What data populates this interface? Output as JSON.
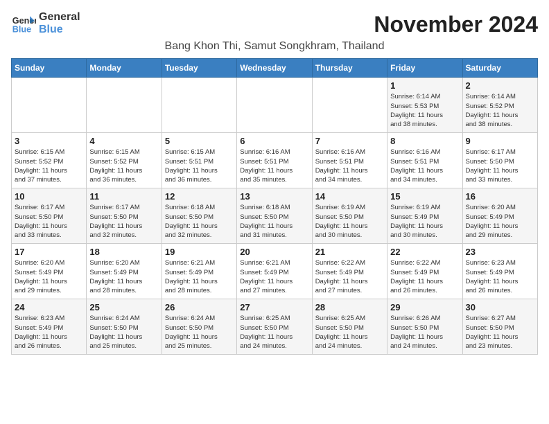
{
  "logo": {
    "line1": "General",
    "line2": "Blue"
  },
  "title": "November 2024",
  "subtitle": "Bang Khon Thi, Samut Songkhram, Thailand",
  "days_of_week": [
    "Sunday",
    "Monday",
    "Tuesday",
    "Wednesday",
    "Thursday",
    "Friday",
    "Saturday"
  ],
  "weeks": [
    [
      {
        "day": "",
        "info": ""
      },
      {
        "day": "",
        "info": ""
      },
      {
        "day": "",
        "info": ""
      },
      {
        "day": "",
        "info": ""
      },
      {
        "day": "",
        "info": ""
      },
      {
        "day": "1",
        "info": "Sunrise: 6:14 AM\nSunset: 5:53 PM\nDaylight: 11 hours\nand 38 minutes."
      },
      {
        "day": "2",
        "info": "Sunrise: 6:14 AM\nSunset: 5:52 PM\nDaylight: 11 hours\nand 38 minutes."
      }
    ],
    [
      {
        "day": "3",
        "info": "Sunrise: 6:15 AM\nSunset: 5:52 PM\nDaylight: 11 hours\nand 37 minutes."
      },
      {
        "day": "4",
        "info": "Sunrise: 6:15 AM\nSunset: 5:52 PM\nDaylight: 11 hours\nand 36 minutes."
      },
      {
        "day": "5",
        "info": "Sunrise: 6:15 AM\nSunset: 5:51 PM\nDaylight: 11 hours\nand 36 minutes."
      },
      {
        "day": "6",
        "info": "Sunrise: 6:16 AM\nSunset: 5:51 PM\nDaylight: 11 hours\nand 35 minutes."
      },
      {
        "day": "7",
        "info": "Sunrise: 6:16 AM\nSunset: 5:51 PM\nDaylight: 11 hours\nand 34 minutes."
      },
      {
        "day": "8",
        "info": "Sunrise: 6:16 AM\nSunset: 5:51 PM\nDaylight: 11 hours\nand 34 minutes."
      },
      {
        "day": "9",
        "info": "Sunrise: 6:17 AM\nSunset: 5:50 PM\nDaylight: 11 hours\nand 33 minutes."
      }
    ],
    [
      {
        "day": "10",
        "info": "Sunrise: 6:17 AM\nSunset: 5:50 PM\nDaylight: 11 hours\nand 33 minutes."
      },
      {
        "day": "11",
        "info": "Sunrise: 6:17 AM\nSunset: 5:50 PM\nDaylight: 11 hours\nand 32 minutes."
      },
      {
        "day": "12",
        "info": "Sunrise: 6:18 AM\nSunset: 5:50 PM\nDaylight: 11 hours\nand 32 minutes."
      },
      {
        "day": "13",
        "info": "Sunrise: 6:18 AM\nSunset: 5:50 PM\nDaylight: 11 hours\nand 31 minutes."
      },
      {
        "day": "14",
        "info": "Sunrise: 6:19 AM\nSunset: 5:50 PM\nDaylight: 11 hours\nand 30 minutes."
      },
      {
        "day": "15",
        "info": "Sunrise: 6:19 AM\nSunset: 5:49 PM\nDaylight: 11 hours\nand 30 minutes."
      },
      {
        "day": "16",
        "info": "Sunrise: 6:20 AM\nSunset: 5:49 PM\nDaylight: 11 hours\nand 29 minutes."
      }
    ],
    [
      {
        "day": "17",
        "info": "Sunrise: 6:20 AM\nSunset: 5:49 PM\nDaylight: 11 hours\nand 29 minutes."
      },
      {
        "day": "18",
        "info": "Sunrise: 6:20 AM\nSunset: 5:49 PM\nDaylight: 11 hours\nand 28 minutes."
      },
      {
        "day": "19",
        "info": "Sunrise: 6:21 AM\nSunset: 5:49 PM\nDaylight: 11 hours\nand 28 minutes."
      },
      {
        "day": "20",
        "info": "Sunrise: 6:21 AM\nSunset: 5:49 PM\nDaylight: 11 hours\nand 27 minutes."
      },
      {
        "day": "21",
        "info": "Sunrise: 6:22 AM\nSunset: 5:49 PM\nDaylight: 11 hours\nand 27 minutes."
      },
      {
        "day": "22",
        "info": "Sunrise: 6:22 AM\nSunset: 5:49 PM\nDaylight: 11 hours\nand 26 minutes."
      },
      {
        "day": "23",
        "info": "Sunrise: 6:23 AM\nSunset: 5:49 PM\nDaylight: 11 hours\nand 26 minutes."
      }
    ],
    [
      {
        "day": "24",
        "info": "Sunrise: 6:23 AM\nSunset: 5:49 PM\nDaylight: 11 hours\nand 26 minutes."
      },
      {
        "day": "25",
        "info": "Sunrise: 6:24 AM\nSunset: 5:50 PM\nDaylight: 11 hours\nand 25 minutes."
      },
      {
        "day": "26",
        "info": "Sunrise: 6:24 AM\nSunset: 5:50 PM\nDaylight: 11 hours\nand 25 minutes."
      },
      {
        "day": "27",
        "info": "Sunrise: 6:25 AM\nSunset: 5:50 PM\nDaylight: 11 hours\nand 24 minutes."
      },
      {
        "day": "28",
        "info": "Sunrise: 6:25 AM\nSunset: 5:50 PM\nDaylight: 11 hours\nand 24 minutes."
      },
      {
        "day": "29",
        "info": "Sunrise: 6:26 AM\nSunset: 5:50 PM\nDaylight: 11 hours\nand 24 minutes."
      },
      {
        "day": "30",
        "info": "Sunrise: 6:27 AM\nSunset: 5:50 PM\nDaylight: 11 hours\nand 23 minutes."
      }
    ]
  ]
}
